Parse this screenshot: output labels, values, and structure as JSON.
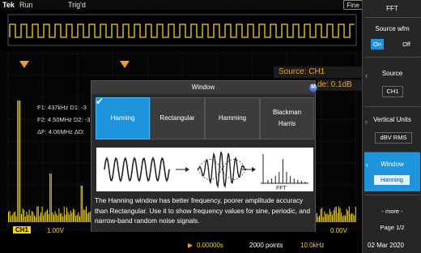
{
  "topbar": {
    "brand": "Tek",
    "run": "Run",
    "trig": "Trig'd",
    "fine": "Fine"
  },
  "cursors": {
    "f1": "F1: 437kHz D1: -3",
    "f2": "F2: 4.50MHz D2: -3",
    "df": "ΔF: 4.06MHz ΔD:"
  },
  "readout": {
    "source": "Source: CH1",
    "scale": "de: 0.1dB"
  },
  "dialog": {
    "title": "Window",
    "badge": "M",
    "options": [
      {
        "label": "Hanning",
        "selected": true
      },
      {
        "label": "Rectangular",
        "selected": false
      },
      {
        "label": "Hamming",
        "selected": false
      },
      {
        "label": "Blackman Harris",
        "selected": false
      }
    ],
    "illustration_label": "FFT",
    "description": "The Hanning window has better frequency, poorer amplitude accuracy than Rectangular. Use it to show frequency values for sine, periodic, and narrow-band random noise signals."
  },
  "menu": {
    "title": "FFT",
    "source_wfm": {
      "label": "Source wfm",
      "on": "On",
      "off": "Off",
      "active": "On"
    },
    "source": {
      "label": "Source",
      "value": "CH1"
    },
    "vertical_units": {
      "label": "Vertical Units",
      "value": "dBV RMS"
    },
    "window": {
      "label": "Window",
      "value": "Hanning"
    },
    "more": "- more -",
    "page": "Page 1/2"
  },
  "bottom": {
    "channel": "CH1",
    "volts": "1.00V",
    "time": "0.00000s",
    "points": "2000 points",
    "freq": "10.0kHz",
    "level": "0.00V",
    "date": "02 Mar 2020"
  },
  "colors": {
    "accent": "#1d94dc",
    "channel": "#f5d21a",
    "readout": "#f0a020"
  },
  "icons": [
    "checkmark-icon",
    "trigger-marker-icon",
    "ground-marker-icon",
    "arrow-left-icon"
  ]
}
